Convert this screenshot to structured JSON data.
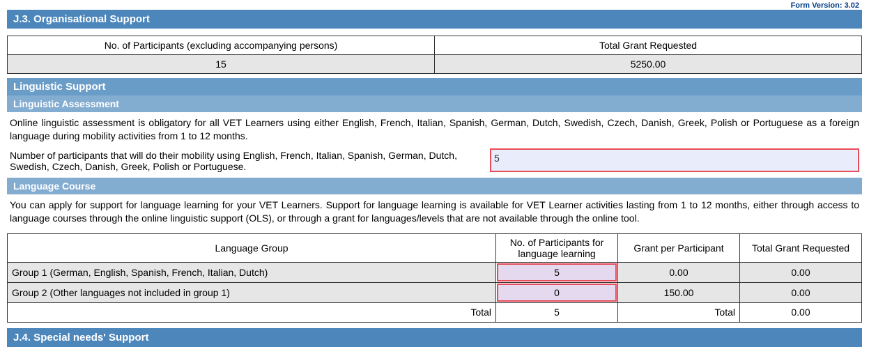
{
  "form_version": "Form Version: 3.02",
  "section_j3": {
    "title": "J.3. Organisational Support",
    "table": {
      "col1": "No. of Participants (excluding accompanying persons)",
      "col2": "Total Grant Requested",
      "val1": "15",
      "val2": "5250.00"
    }
  },
  "linguistic_support": {
    "title": "Linguistic Support"
  },
  "linguistic_assessment": {
    "title": "Linguistic Assessment",
    "body": "Online linguistic assessment is obligatory for all VET Learners using either English, French, Italian, Spanish, German, Dutch, Swedish, Czech, Danish, Greek, Polish or Portuguese as a foreign language during mobility activities from 1 to 12 months.",
    "field_label": "Number of participants that will do their mobility using English, French, Italian, Spanish, German, Dutch, Swedish, Czech, Danish, Greek, Polish or Portuguese.",
    "field_value": "5"
  },
  "language_course": {
    "title": "Language Course",
    "body": "You can apply for support for language learning for your VET Learners. Support for language learning is available for VET Learner activities lasting from 1 to 12 months, either through access to language courses through the online linguistic support (OLS), or through a grant for languages/levels that are not available through the online tool.",
    "headers": {
      "col1": "Language Group",
      "col2": "No. of Participants for language learning",
      "col3": "Grant per Participant",
      "col4": "Total Grant Requested"
    },
    "rows": [
      {
        "label": "Group 1 (German, English, Spanish, French, Italian, Dutch)",
        "participants": "5",
        "grant_per": "0.00",
        "total": "0.00"
      },
      {
        "label": "Group 2 (Other languages not included in group 1)",
        "participants": "0",
        "grant_per": "150.00",
        "total": "0.00"
      }
    ],
    "totals_row": {
      "label_left": "Total",
      "participants_total": "5",
      "label_right": "Total",
      "grand_total": "0.00"
    }
  },
  "section_j4": {
    "title": "J.4. Special needs' Support"
  }
}
